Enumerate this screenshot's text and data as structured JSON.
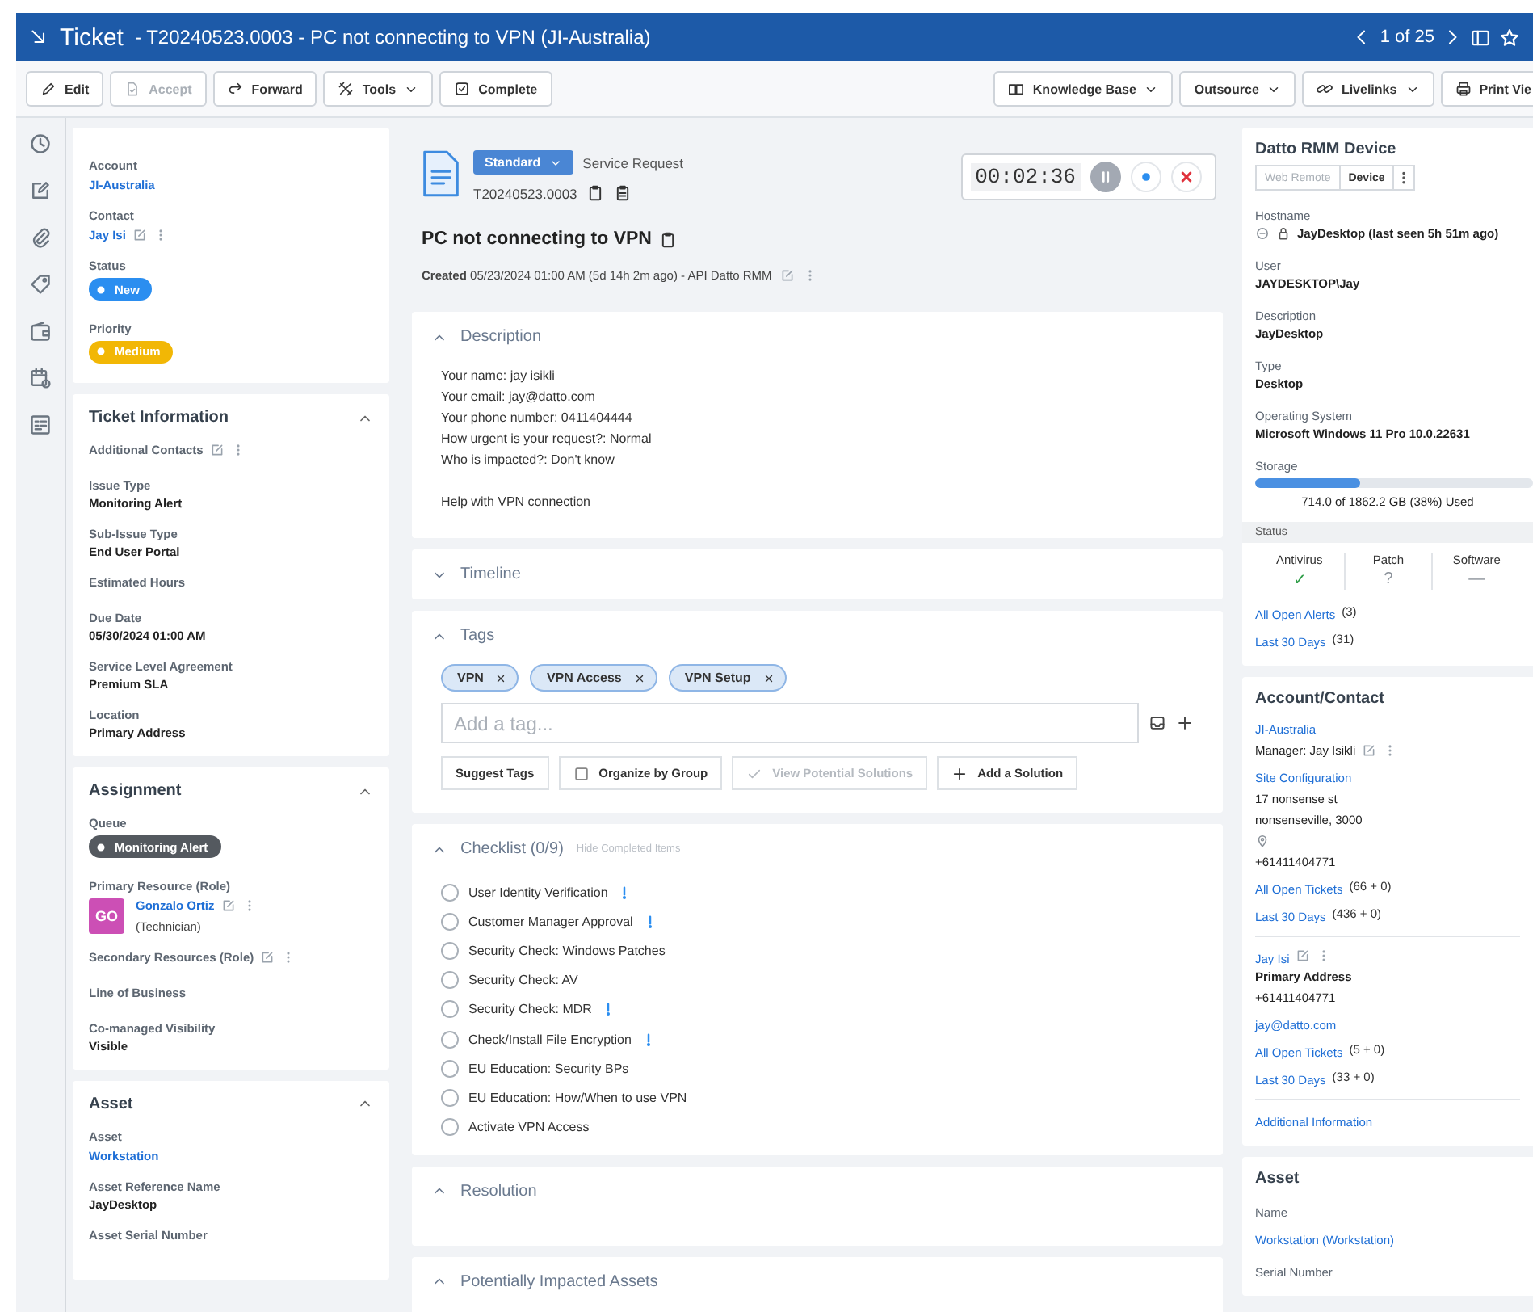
{
  "header": {
    "title": "Ticket",
    "subtitle": "- T20240523.0003 - PC not connecting to VPN (JI-Australia)",
    "pager": "1 of 25"
  },
  "toolbar": {
    "left": [
      {
        "label": "Edit",
        "disabled": false,
        "dropdown": false
      },
      {
        "label": "Accept",
        "disabled": true,
        "dropdown": false
      },
      {
        "label": "Forward",
        "disabled": false,
        "dropdown": false
      },
      {
        "label": "Tools",
        "disabled": false,
        "dropdown": true
      },
      {
        "label": "Complete",
        "disabled": false,
        "dropdown": false
      }
    ],
    "right": [
      {
        "label": "Knowledge Base",
        "disabled": false,
        "dropdown": true
      },
      {
        "label": "Outsource",
        "disabled": false,
        "dropdown": true
      },
      {
        "label": "Livelinks",
        "disabled": false,
        "dropdown": true
      },
      {
        "label": "Print Vie",
        "disabled": false,
        "dropdown": false
      }
    ]
  },
  "left_panel": {
    "cards": [
      {
        "rows": [
          {
            "kind": "label",
            "text": "Account"
          },
          {
            "kind": "link",
            "text": "JI-Australia"
          },
          {
            "kind": "label",
            "text": "Contact"
          },
          {
            "kind": "link",
            "text": "Jay Isi",
            "actions": true
          },
          {
            "kind": "label",
            "text": "Status"
          },
          {
            "kind": "badge",
            "text": "New",
            "color": "#2b8ef0"
          },
          {
            "kind": "label",
            "text": "Priority"
          },
          {
            "kind": "badge",
            "text": "Medium",
            "color": "#f2b705"
          }
        ]
      },
      {
        "title": "Ticket Information",
        "expanded": true,
        "rows": [
          {
            "kind": "label",
            "text": "Additional Contacts",
            "actions": true
          },
          {
            "kind": "label",
            "text": "Issue Type"
          },
          {
            "kind": "value",
            "text": "Monitoring Alert"
          },
          {
            "kind": "label",
            "text": "Sub-Issue Type"
          },
          {
            "kind": "value",
            "text": "End User Portal"
          },
          {
            "kind": "label",
            "text": "Estimated Hours"
          },
          {
            "kind": "label",
            "text": "Due Date"
          },
          {
            "kind": "value",
            "text": "05/30/2024 01:00 AM"
          },
          {
            "kind": "label",
            "text": "Service Level Agreement"
          },
          {
            "kind": "value",
            "text": "Premium SLA"
          },
          {
            "kind": "label",
            "text": "Location"
          },
          {
            "kind": "value",
            "text": "Primary Address"
          }
        ]
      },
      {
        "title": "Assignment",
        "expanded": true,
        "rows": [
          {
            "kind": "label",
            "text": "Queue"
          },
          {
            "kind": "badge",
            "text": "Monitoring Alert",
            "color": "#54595f"
          },
          {
            "kind": "label",
            "text": "Primary Resource (Role)"
          },
          {
            "kind": "avatar",
            "initials": "GO",
            "color": "#cc4fb5",
            "name": "Gonzalo Ortiz",
            "role": "(Technician)",
            "actions": true
          },
          {
            "kind": "label",
            "text": "Secondary Resources (Role)",
            "actions": true
          },
          {
            "kind": "label",
            "text": "Line of Business"
          },
          {
            "kind": "label",
            "text": "Co-managed Visibility"
          },
          {
            "kind": "value",
            "text": "Visible"
          }
        ]
      },
      {
        "title": "Asset",
        "expanded": true,
        "rows": [
          {
            "kind": "label",
            "text": "Asset"
          },
          {
            "kind": "link",
            "text": "Workstation"
          },
          {
            "kind": "label",
            "text": "Asset Reference Name"
          },
          {
            "kind": "value",
            "text": "JayDesktop"
          },
          {
            "kind": "label",
            "text": "Asset Serial Number"
          }
        ]
      }
    ]
  },
  "middle": {
    "ticket": {
      "category": "Standard",
      "type": "Service Request",
      "number": "T20240523.0003",
      "title": "PC not connecting to VPN",
      "created": "**Created** 05/23/2024 01:00 AM (5d 14h 2m ago) - API Datto RMM"
    },
    "timer": {
      "time": "00:02:36"
    },
    "sections": [
      {
        "title": "Description",
        "expanded": true,
        "kind": "text",
        "paragraphs": [
          [
            "Your name: jay isikli",
            "Your email: jay@datto.com",
            "Your phone number: 0411404444",
            "How urgent is your request?: Normal",
            "Who is impacted?: Don't know"
          ],
          [
            "Help with VPN connection"
          ]
        ]
      },
      {
        "title": "Timeline",
        "expanded": false,
        "kind": "empty"
      },
      {
        "title": "Tags",
        "expanded": true,
        "kind": "tags",
        "tags": [
          "VPN",
          "VPN Access",
          "VPN Setup"
        ],
        "placeholder": "Add a tag...",
        "buttons": [
          {
            "label": "Suggest Tags",
            "kind": "plain",
            "disabled": false
          },
          {
            "label": "Organize by Group",
            "kind": "checkbox",
            "checked": false,
            "disabled": false
          },
          {
            "label": "View Potential Solutions",
            "kind": "check",
            "disabled": true
          },
          {
            "label": "Add a Solution",
            "kind": "plus",
            "disabled": false
          }
        ]
      },
      {
        "title": "Checklist (0/9)",
        "note": "Hide Completed Items",
        "expanded": true,
        "kind": "checklist",
        "items": [
          {
            "label": "User Identity Verification",
            "checked": false,
            "important": true
          },
          {
            "label": "Customer Manager Approval",
            "checked": false,
            "important": true
          },
          {
            "label": "Security Check: Windows Patches",
            "checked": false,
            "important": false
          },
          {
            "label": "Security Check: AV",
            "checked": false,
            "important": false
          },
          {
            "label": "Security Check: MDR",
            "checked": false,
            "important": true
          },
          {
            "label": "Check/Install File Encryption",
            "checked": false,
            "important": true
          },
          {
            "label": "EU Education: Security BPs",
            "checked": false,
            "important": false
          },
          {
            "label": "EU Education: How/When to use VPN",
            "checked": false,
            "important": false
          },
          {
            "label": "Activate VPN Access",
            "checked": false,
            "important": false
          }
        ]
      },
      {
        "title": "Resolution",
        "expanded": true,
        "kind": "empty"
      },
      {
        "title": "Potentially Impacted Assets",
        "expanded": true,
        "kind": "empty"
      }
    ]
  },
  "right_panel": {
    "cards": [
      {
        "title": "Datto RMM Device",
        "rows": [
          {
            "kind": "tabs",
            "tabs": [
              {
                "label": "Web Remote",
                "selected": false
              },
              {
                "label": "Device",
                "selected": true
              }
            ]
          },
          {
            "kind": "label",
            "text": "Hostname"
          },
          {
            "kind": "hostname",
            "text": "JayDesktop (last seen 5h 51m ago)"
          },
          {
            "kind": "label",
            "text": "User"
          },
          {
            "kind": "value",
            "text": "JAYDESKTOP\\Jay"
          },
          {
            "kind": "label",
            "text": "Description"
          },
          {
            "kind": "value",
            "text": "JayDesktop"
          },
          {
            "kind": "label",
            "text": "Type"
          },
          {
            "kind": "value",
            "text": "Desktop"
          },
          {
            "kind": "label",
            "text": "Operating System"
          },
          {
            "kind": "value",
            "text": "Microsoft Windows 11 Pro 10.0.22631"
          },
          {
            "kind": "label",
            "text": "Storage"
          },
          {
            "kind": "storage",
            "level": 0.38,
            "reading": "714.0 of 1862.2 GB (38%) Used"
          },
          {
            "kind": "band",
            "text": "Status"
          },
          {
            "kind": "status",
            "items": [
              {
                "label": "Antivirus",
                "value": "✓",
                "kind": "ok"
              },
              {
                "label": "Patch",
                "value": "?",
                "kind": "unknown"
              },
              {
                "label": "Software",
                "value": "—",
                "kind": "none"
              }
            ]
          },
          {
            "kind": "link",
            "text": "All Open Alerts",
            "count": "(3)"
          },
          {
            "kind": "link",
            "text": "Last 30 Days",
            "count": "(31)"
          }
        ]
      },
      {
        "title": "Account/Contact",
        "rows": [
          {
            "kind": "link",
            "text": "JI-Australia"
          },
          {
            "kind": "text",
            "text": "Manager: Jay Isikli",
            "actions": true
          },
          {
            "kind": "link",
            "text": "Site Configuration"
          },
          {
            "kind": "text",
            "text": "17 nonsense st"
          },
          {
            "kind": "text",
            "text": "nonsenseville,  3000"
          },
          {
            "kind": "pin"
          },
          {
            "kind": "text",
            "text": "+61411404771"
          },
          {
            "kind": "link",
            "text": "All Open Tickets",
            "count": "(66 + 0)"
          },
          {
            "kind": "link",
            "text": "Last 30 Days",
            "count": "(436 + 0)"
          },
          {
            "kind": "divider"
          },
          {
            "kind": "link",
            "text": "Jay Isi",
            "actions": true
          },
          {
            "kind": "value",
            "text": "Primary Address"
          },
          {
            "kind": "text",
            "text": "+61411404771"
          },
          {
            "kind": "link",
            "text": "jay@datto.com"
          },
          {
            "kind": "link",
            "text": "All Open Tickets",
            "count": "(5 + 0)"
          },
          {
            "kind": "link",
            "text": "Last 30 Days",
            "count": "(33 + 0)"
          },
          {
            "kind": "divider"
          },
          {
            "kind": "link",
            "text": "Additional Information"
          }
        ]
      },
      {
        "title": "Asset",
        "rows": [
          {
            "kind": "label",
            "text": "Name"
          },
          {
            "kind": "link",
            "text": "Workstation (Workstation)"
          },
          {
            "kind": "label",
            "text": "Serial Number"
          }
        ]
      }
    ]
  }
}
